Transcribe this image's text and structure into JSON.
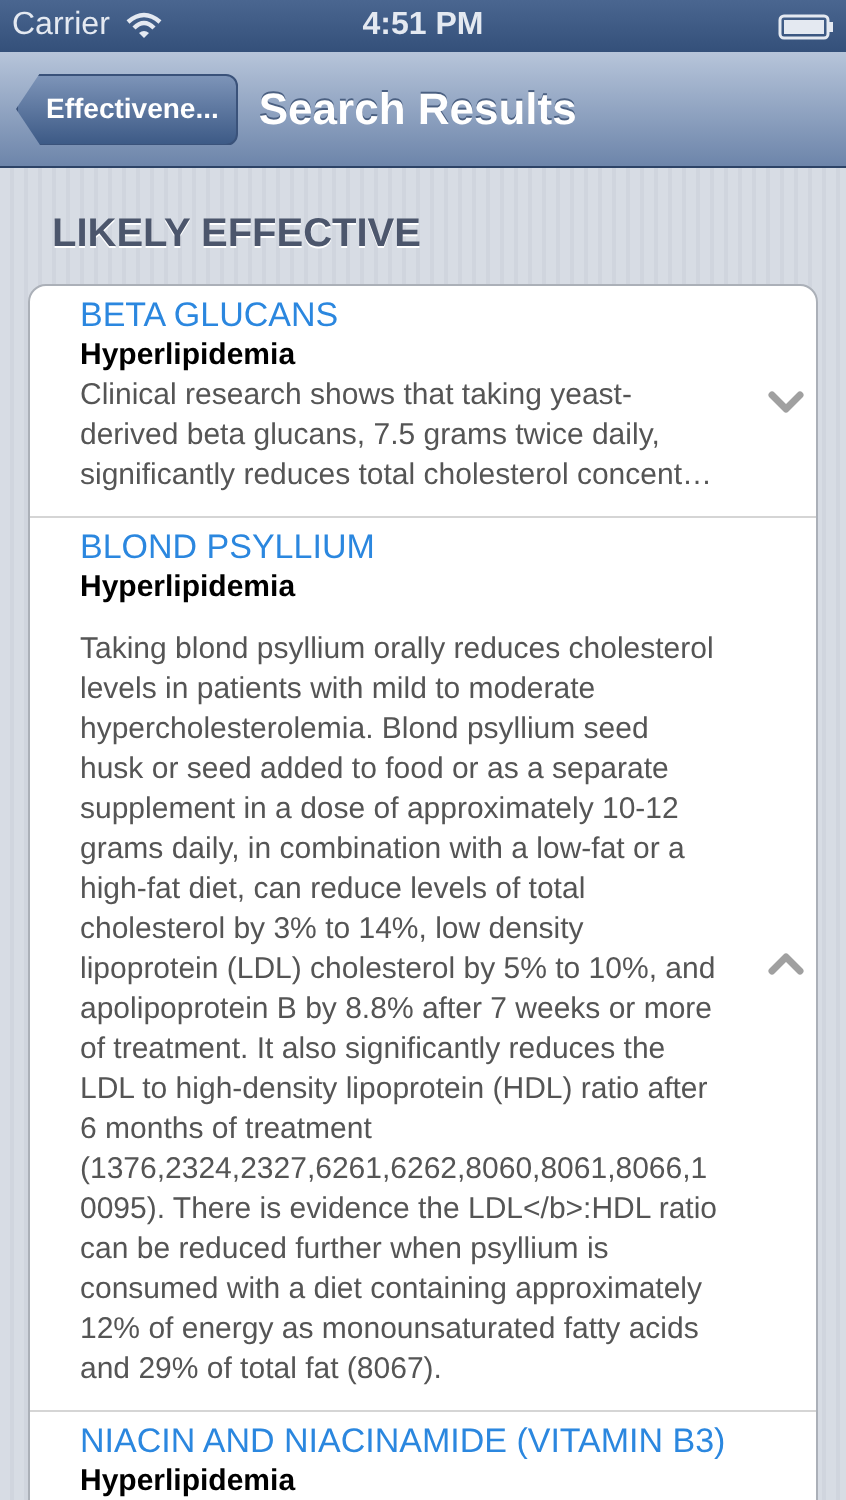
{
  "status_bar": {
    "carrier": "Carrier",
    "time": "4:51 PM"
  },
  "nav_bar": {
    "back": "Effectivene...",
    "title": "Search Results"
  },
  "section": {
    "header": "LIKELY EFFECTIVE",
    "results": [
      {
        "title": "BETA GLUCANS",
        "condition": "Hyperlipidemia",
        "expanded": false,
        "description_lines": [
          "Clinical research shows that taking yeast-",
          "derived beta glucans, 7.5 grams twice daily,",
          "significantly reduces total cholesterol concent…"
        ]
      },
      {
        "title": "BLOND PSYLLIUM",
        "condition": "Hyperlipidemia",
        "expanded": true,
        "description_lines": [
          "Taking blond psyllium orally reduces cholesterol",
          "levels in patients with mild to moderate",
          "hypercholesterolemia. Blond psyllium seed",
          "husk or seed added to food or as a separate",
          "supplement in a dose of approximately 10-12",
          "grams daily, in combination with a low-fat or a",
          "high-fat diet, can reduce levels of total",
          "cholesterol by 3% to 14%, low density",
          "lipoprotein (LDL) cholesterol by 5% to 10%, and",
          "apolipoprotein B by 8.8% after 7 weeks or more",
          "of treatment. It also significantly reduces the",
          "LDL to high-density lipoprotein (HDL) ratio after",
          "6 months of treatment",
          "(1376,2324,2327,6261,6262,8060,8061,8066,1",
          "0095). There is evidence the LDL</b>:HDL ratio",
          "can be reduced further when psyllium is",
          "consumed with a diet containing approximately",
          "12% of energy as monounsaturated fatty acids",
          "and 29% of total fat (8067)."
        ]
      },
      {
        "title": "NIACIN AND NIACINAMIDE (VITAMIN B3)",
        "condition": "Hyperlipidemia"
      }
    ]
  }
}
